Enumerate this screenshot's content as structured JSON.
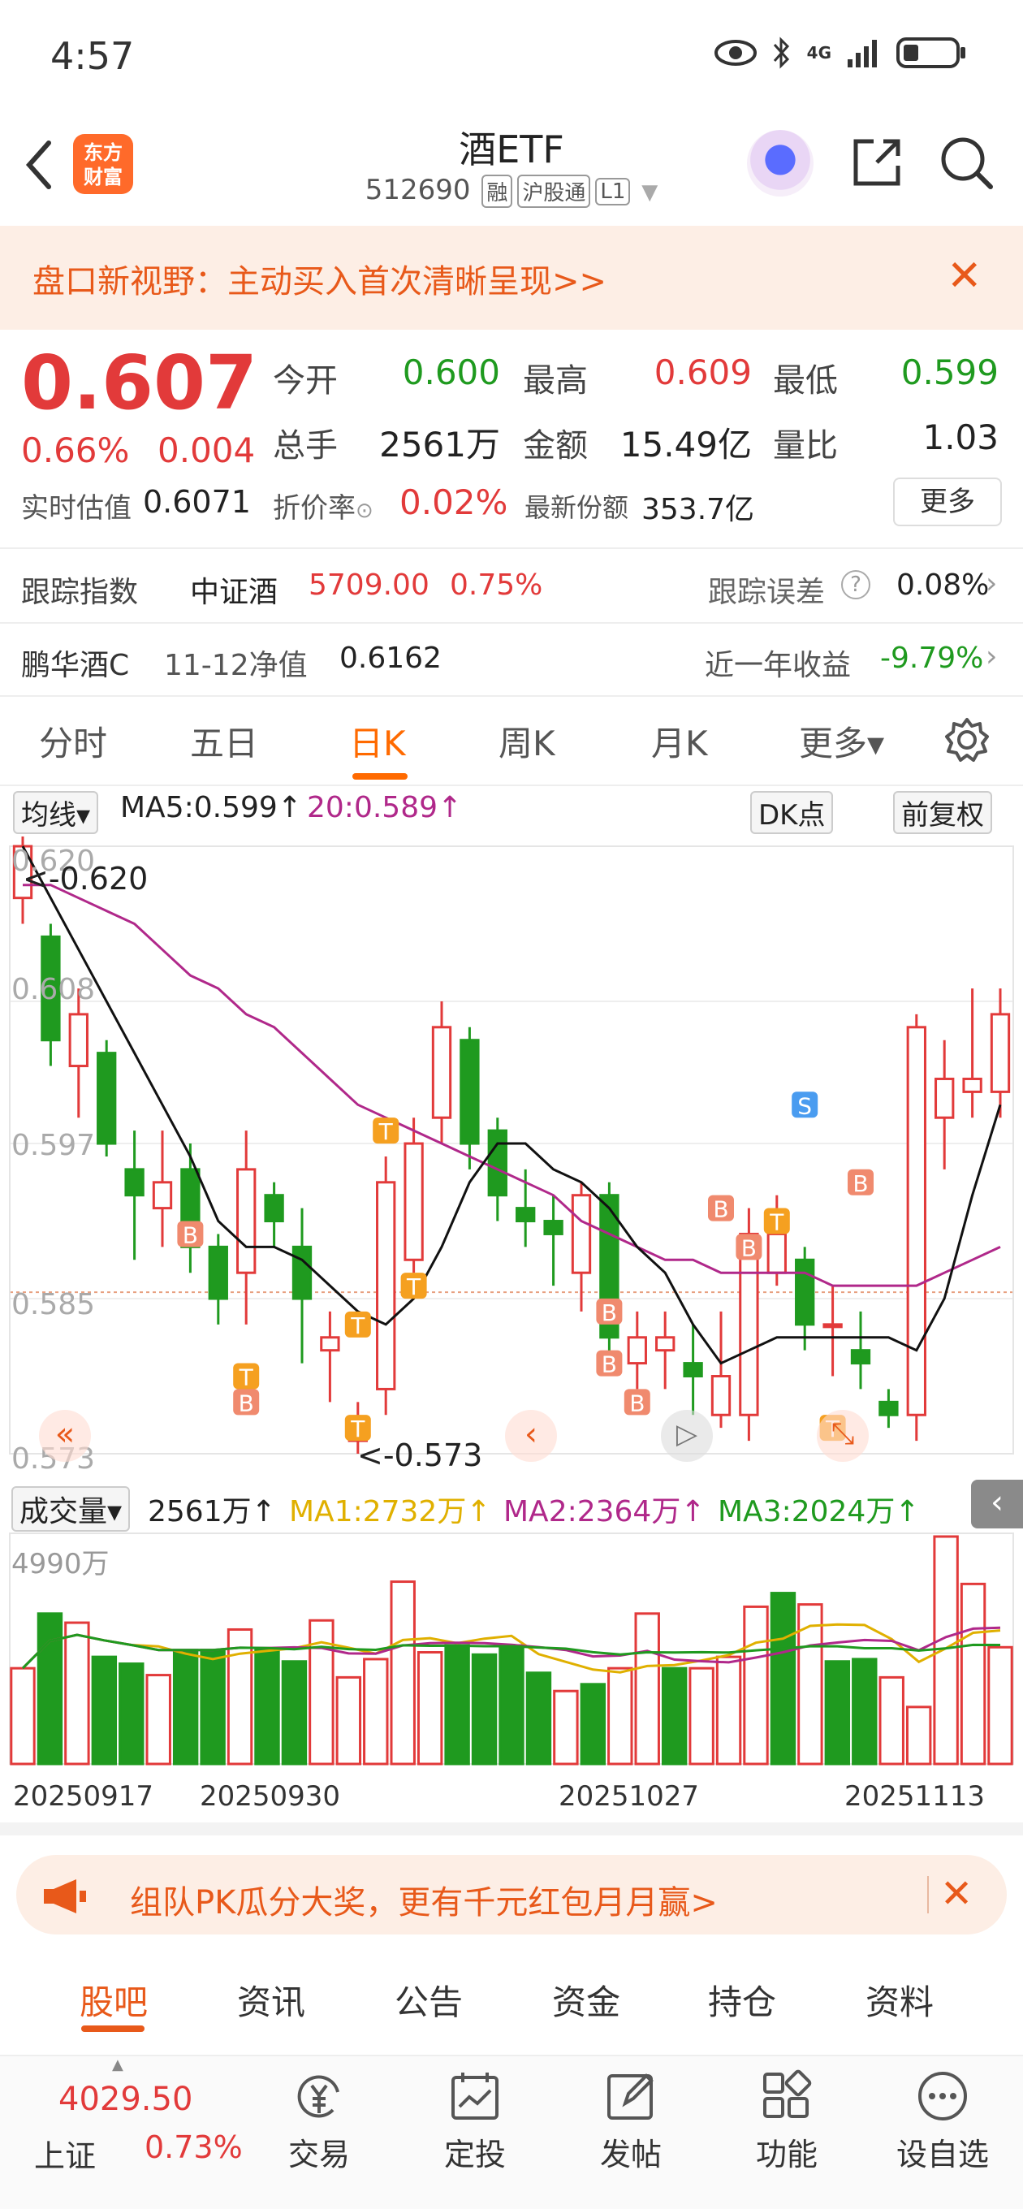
{
  "status_bar": {
    "time": "4:57",
    "network": "4G"
  },
  "header": {
    "title": "酒ETF",
    "code": "512690",
    "tags": [
      "融",
      "沪股通",
      "L1"
    ],
    "logo_text_1": "东方",
    "logo_text_2": "财富"
  },
  "banner": {
    "text": "盘口新视野：主动买入首次清晰呈现>>"
  },
  "quote": {
    "price": "0.607",
    "change_pct": "0.66%",
    "change": "0.004",
    "open_label": "今开",
    "open": "0.600",
    "high_label": "最高",
    "high": "0.609",
    "low_label": "最低",
    "low": "0.599",
    "volume_label": "总手",
    "volume": "2561万",
    "amount_label": "金额",
    "amount": "15.49亿",
    "ratio_label": "量比",
    "ratio": "1.03",
    "est_label": "实时估值",
    "est": "0.6071",
    "discount_label": "折价率",
    "discount": "0.02%",
    "share_label": "最新份额",
    "share": "353.7亿",
    "more": "更多"
  },
  "tracking": {
    "label": "跟踪指数",
    "index": "中证酒",
    "index_value": "5709.00",
    "index_pct": "0.75%",
    "error_label": "跟踪误差",
    "error": "0.08%"
  },
  "fund": {
    "name": "鹏华酒C",
    "nav_label": "11-12净值",
    "nav": "0.6162",
    "yield_label": "近一年收益",
    "yield": "-9.79%"
  },
  "tabs": [
    "分时",
    "五日",
    "日K",
    "周K",
    "月K",
    "更多▾"
  ],
  "chart_header": {
    "ma_select": "均线▾",
    "ma5": "MA5:0.599↑",
    "ma20": "20:0.589↑",
    "dk": "DK点",
    "adjust": "前复权"
  },
  "volume_header": {
    "select": "成交量▾",
    "vol": "2561万↑",
    "ma1": "MA1:2732万↑",
    "ma2": "MA2:2364万↑",
    "ma3": "MA3:2024万↑",
    "max": "4990万"
  },
  "chart_annotations": {
    "high": "<-0.620",
    "low": "<-0.573"
  },
  "chart_data": {
    "type": "candlestick",
    "y_ticks": [
      "0.620",
      "0.608",
      "0.597",
      "0.585",
      "0.573"
    ],
    "ylim": [
      0.573,
      0.62
    ],
    "x_ticks": [
      "20250917",
      "20250930",
      "20251027",
      "20251113"
    ],
    "candles": [
      {
        "o": 0.616,
        "c": 0.62,
        "h": 0.621,
        "l": 0.614
      },
      {
        "o": 0.613,
        "c": 0.605,
        "h": 0.614,
        "l": 0.603
      },
      {
        "o": 0.603,
        "c": 0.607,
        "h": 0.609,
        "l": 0.599
      },
      {
        "o": 0.604,
        "c": 0.597,
        "h": 0.605,
        "l": 0.596
      },
      {
        "o": 0.595,
        "c": 0.593,
        "h": 0.598,
        "l": 0.588
      },
      {
        "o": 0.592,
        "c": 0.594,
        "h": 0.598,
        "l": 0.589
      },
      {
        "o": 0.595,
        "c": 0.589,
        "h": 0.597,
        "l": 0.587
      },
      {
        "o": 0.589,
        "c": 0.585,
        "h": 0.59,
        "l": 0.583
      },
      {
        "o": 0.587,
        "c": 0.595,
        "h": 0.598,
        "l": 0.583
      },
      {
        "o": 0.593,
        "c": 0.591,
        "h": 0.594,
        "l": 0.589
      },
      {
        "o": 0.589,
        "c": 0.585,
        "h": 0.592,
        "l": 0.58
      },
      {
        "o": 0.581,
        "c": 0.582,
        "h": 0.584,
        "l": 0.577
      },
      {
        "o": 0.574,
        "c": 0.575,
        "h": 0.577,
        "l": 0.573
      },
      {
        "o": 0.578,
        "c": 0.594,
        "h": 0.596,
        "l": 0.576
      },
      {
        "o": 0.588,
        "c": 0.597,
        "h": 0.599,
        "l": 0.587
      },
      {
        "o": 0.599,
        "c": 0.606,
        "h": 0.608,
        "l": 0.597
      },
      {
        "o": 0.605,
        "c": 0.597,
        "h": 0.606,
        "l": 0.595
      },
      {
        "o": 0.598,
        "c": 0.593,
        "h": 0.599,
        "l": 0.591
      },
      {
        "o": 0.592,
        "c": 0.591,
        "h": 0.595,
        "l": 0.589
      },
      {
        "o": 0.591,
        "c": 0.59,
        "h": 0.593,
        "l": 0.586
      },
      {
        "o": 0.587,
        "c": 0.593,
        "h": 0.594,
        "l": 0.584
      },
      {
        "o": 0.593,
        "c": 0.582,
        "h": 0.594,
        "l": 0.58
      },
      {
        "o": 0.58,
        "c": 0.582,
        "h": 0.584,
        "l": 0.578
      },
      {
        "o": 0.581,
        "c": 0.582,
        "h": 0.584,
        "l": 0.578
      },
      {
        "o": 0.58,
        "c": 0.579,
        "h": 0.583,
        "l": 0.576
      },
      {
        "o": 0.576,
        "c": 0.579,
        "h": 0.584,
        "l": 0.575
      },
      {
        "o": 0.576,
        "c": 0.59,
        "h": 0.592,
        "l": 0.574
      },
      {
        "o": 0.587,
        "c": 0.59,
        "h": 0.593,
        "l": 0.586
      },
      {
        "o": 0.588,
        "c": 0.583,
        "h": 0.589,
        "l": 0.581
      },
      {
        "o": 0.583,
        "c": 0.583,
        "h": 0.586,
        "l": 0.579
      },
      {
        "o": 0.581,
        "c": 0.58,
        "h": 0.584,
        "l": 0.578
      },
      {
        "o": 0.577,
        "c": 0.576,
        "h": 0.578,
        "l": 0.575
      },
      {
        "o": 0.576,
        "c": 0.606,
        "h": 0.607,
        "l": 0.574
      },
      {
        "o": 0.599,
        "c": 0.602,
        "h": 0.605,
        "l": 0.595
      },
      {
        "o": 0.601,
        "c": 0.602,
        "h": 0.609,
        "l": 0.599
      },
      {
        "o": 0.601,
        "c": 0.607,
        "h": 0.609,
        "l": 0.599
      }
    ],
    "ma5": [
      0.62,
      0.616,
      0.612,
      0.608,
      0.604,
      0.6,
      0.596,
      0.591,
      0.589,
      0.589,
      0.588,
      0.586,
      0.584,
      0.583,
      0.585,
      0.589,
      0.594,
      0.597,
      0.597,
      0.595,
      0.594,
      0.592,
      0.589,
      0.587,
      0.583,
      0.58,
      0.581,
      0.582,
      0.582,
      0.582,
      0.582,
      0.582,
      0.581,
      0.585,
      0.593,
      0.6
    ],
    "ma20": [
      0.617,
      0.617,
      0.616,
      0.615,
      0.614,
      0.612,
      0.61,
      0.609,
      0.607,
      0.606,
      0.604,
      0.602,
      0.6,
      0.599,
      0.598,
      0.597,
      0.596,
      0.595,
      0.594,
      0.593,
      0.591,
      0.59,
      0.589,
      0.588,
      0.588,
      0.587,
      0.587,
      0.587,
      0.587,
      0.586,
      0.586,
      0.586,
      0.586,
      0.587,
      0.588,
      0.589
    ],
    "volumes": [
      2100,
      3300,
      3100,
      2350,
      2200,
      1950,
      2500,
      2500,
      2950,
      2500,
      2250,
      3150,
      1900,
      2300,
      4000,
      2450,
      2600,
      2400,
      2600,
      2000,
      1600,
      1750,
      2100,
      3300,
      2100,
      2100,
      2350,
      3450,
      3750,
      3500,
      2250,
      2300,
      1900,
      1250,
      4990,
      3950,
      2561
    ]
  },
  "chart_markers": {
    "b": "B",
    "t": "T",
    "s": "S"
  },
  "promo": {
    "text": "组队PK瓜分大奖，更有千元红包月月赢>"
  },
  "bottom_tabs": [
    "股吧",
    "资讯",
    "公告",
    "资金",
    "持仓",
    "资料"
  ],
  "index_bar": {
    "value": "4029.50",
    "name": "上证",
    "pct": "0.73%"
  },
  "nav": [
    "交易",
    "定投",
    "发帖",
    "功能",
    "设自选"
  ],
  "colors": {
    "up": "#e23a3a",
    "down": "#1f9a1f",
    "accent": "#ff6a00",
    "ma5": "#111111",
    "ma20": "#b0288a"
  }
}
